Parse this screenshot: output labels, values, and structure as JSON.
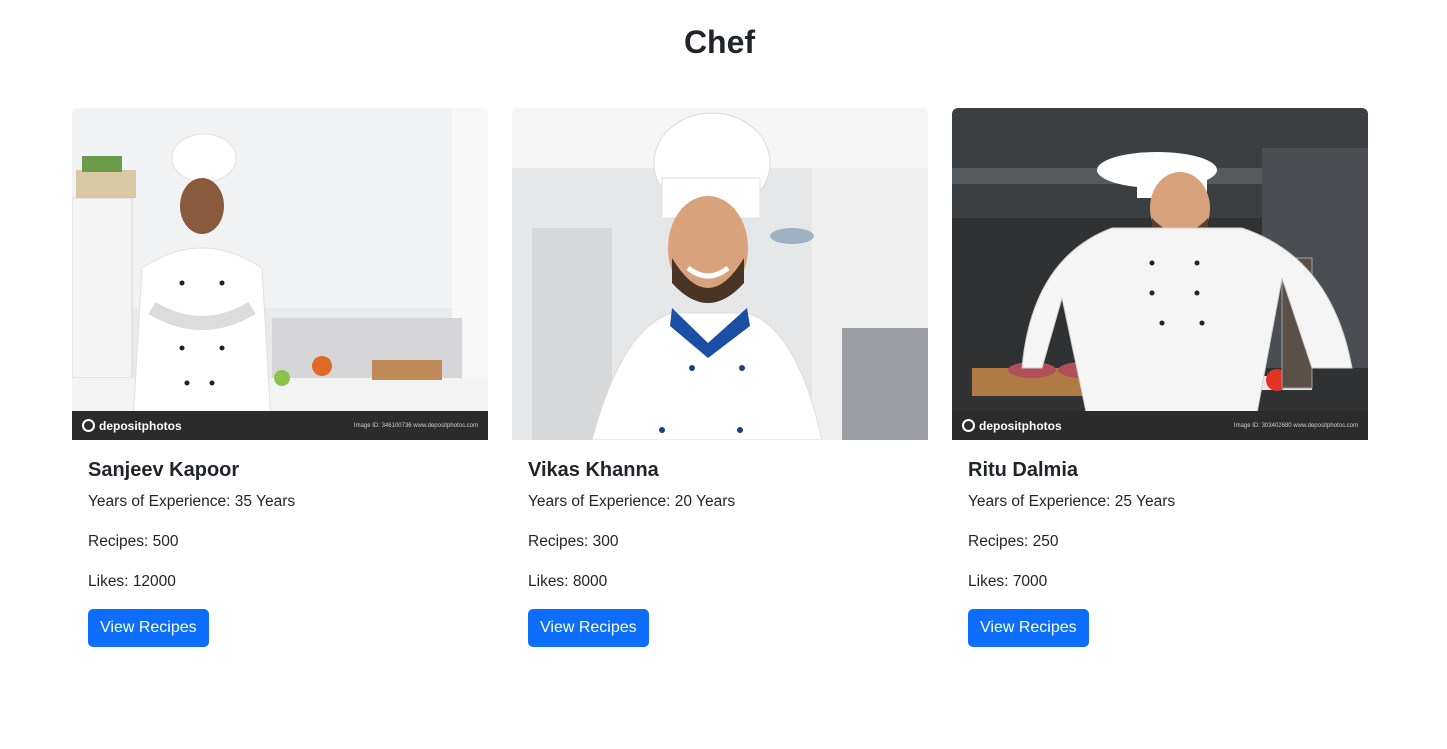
{
  "page": {
    "title": "Chef"
  },
  "chefs": [
    {
      "name": "Sanjeev Kapoor",
      "experience_label": "Years of Experience: ",
      "experience_value": "35 Years",
      "recipes_label": "Recipes: ",
      "recipes_value": "500",
      "likes_label": "Likes: ",
      "likes_value": "12000",
      "button_label": "View Recipes",
      "photo_watermark": "depositphotos",
      "photo_caption": "Image ID: 346100736   www.depositphotos.com"
    },
    {
      "name": "Vikas Khanna",
      "experience_label": "Years of Experience: ",
      "experience_value": "20 Years",
      "recipes_label": "Recipes: ",
      "recipes_value": "300",
      "likes_label": "Likes: ",
      "likes_value": "8000",
      "button_label": "View Recipes"
    },
    {
      "name": "Ritu Dalmia",
      "experience_label": "Years of Experience: ",
      "experience_value": "25 Years",
      "recipes_label": "Recipes: ",
      "recipes_value": "250",
      "likes_label": "Likes: ",
      "likes_value": "7000",
      "button_label": "View Recipes",
      "photo_watermark": "depositphotos",
      "photo_caption": "Image ID: 303402680   www.depositphotos.com"
    }
  ],
  "colors": {
    "primary_button": "#0d6efd",
    "text": "#212529"
  }
}
